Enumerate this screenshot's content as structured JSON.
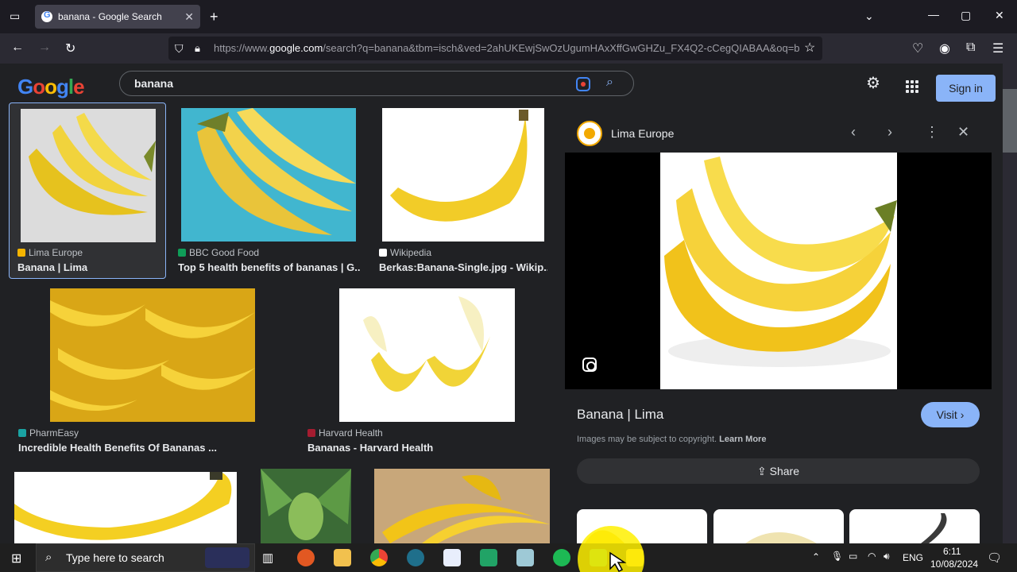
{
  "browser": {
    "tab_title": "banana - Google Search",
    "url_prefix": "https://www.",
    "url_domain": "google.com",
    "url_rest": "/search?q=banana&tbm=isch&ved=2ahUKEwjSwOzUgumHAxXffGwGHZu_FX4Q2-cCegQIABAA&oq=b"
  },
  "google": {
    "logo": [
      "G",
      "o",
      "o",
      "g",
      "l",
      "e"
    ],
    "query": "banana",
    "signin_label": "Sign in"
  },
  "results": [
    {
      "source": "Lima Europe",
      "title": "Banana | Lima",
      "fav": "#f4b400"
    },
    {
      "source": "BBC Good Food",
      "title": "Top 5 health benefits of bananas | G...",
      "fav": "#0f9d58"
    },
    {
      "source": "Wikipedia",
      "title": "Berkas:Banana-Single.jpg - Wikip...",
      "fav": "#ffffff"
    },
    {
      "source": "PharmEasy",
      "title": "Incredible Health Benefits Of Bananas ...",
      "fav": "#1aa3a3"
    },
    {
      "source": "Harvard Health",
      "title": "Bananas - Harvard Health",
      "fav": "#a51c30"
    }
  ],
  "panel": {
    "source": "Lima Europe",
    "title": "Banana | Lima",
    "visit_label": "Visit",
    "copyright_text": "Images may be subject to copyright.",
    "learn_more": "Learn More",
    "share_label": "Share"
  },
  "taskbar": {
    "search_placeholder": "Type here to search",
    "lang": "ENG",
    "time": "6:11",
    "date": "10/08/2024"
  },
  "colors": {
    "accent": "#8ab4f8",
    "banana": "#f6d23a"
  }
}
